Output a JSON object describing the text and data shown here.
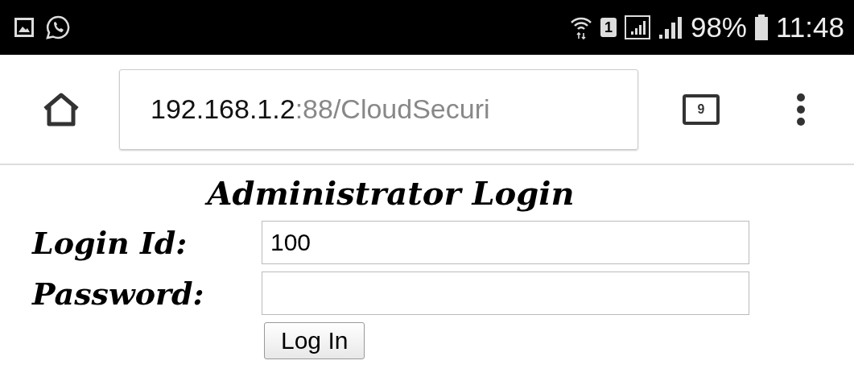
{
  "status_bar": {
    "battery": "98%",
    "time": "11:48",
    "sim_slot": "1"
  },
  "browser": {
    "url": {
      "host": "192.168.1.2",
      "rest": ":88/CloudSecuri"
    },
    "tab_count": "9"
  },
  "form": {
    "title": "Administrator Login",
    "fields": [
      {
        "label": "Login Id:",
        "value": "100",
        "kind": "text"
      },
      {
        "label": "Password:",
        "kind": "password"
      }
    ],
    "button": "Log In"
  }
}
